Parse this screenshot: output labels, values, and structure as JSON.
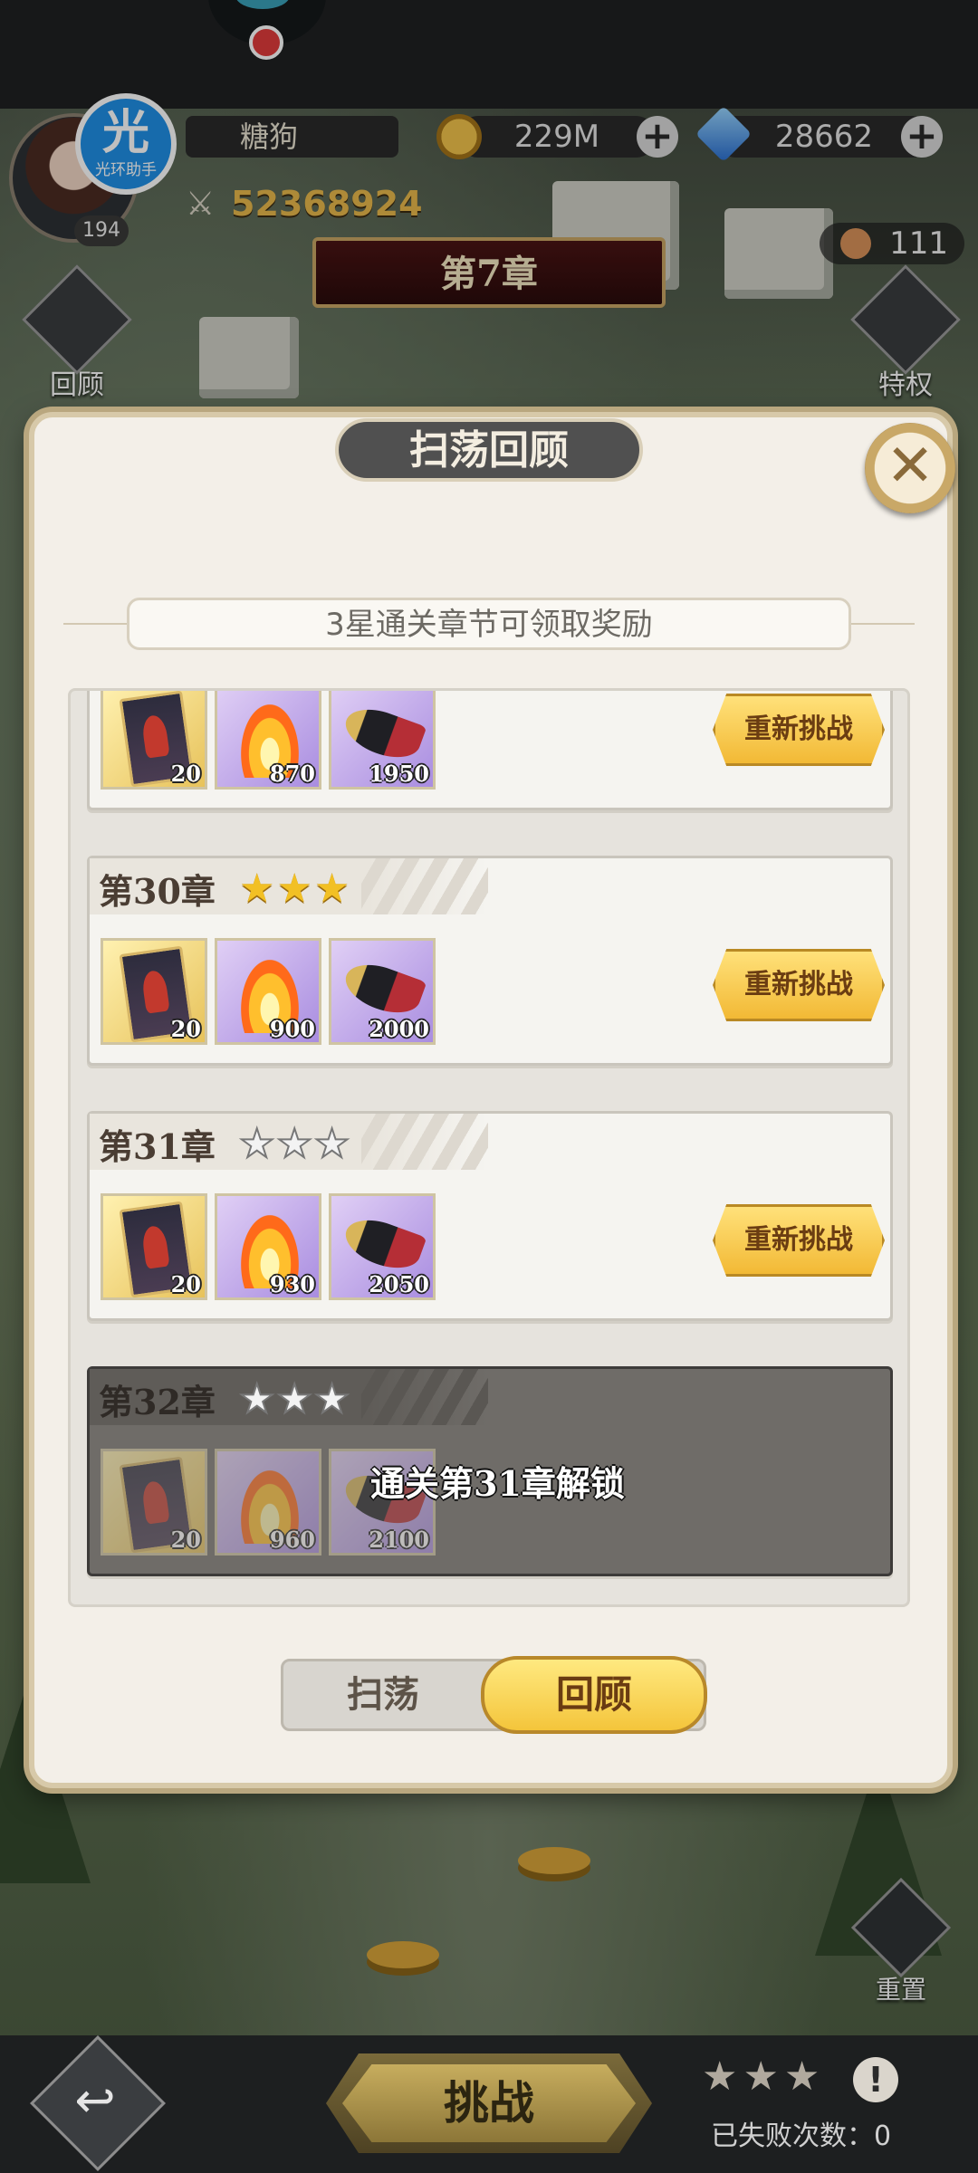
{
  "hud": {
    "player_name": "糖狗",
    "level": "194",
    "gold": "229M",
    "gems": "28662",
    "power": "52368924",
    "tokens": "111",
    "logo_glyph": "光",
    "logo_text": "光环助手",
    "chapter_banner": "第7章",
    "left_button": "回顾",
    "right_button": "特权",
    "reset_button": "重置"
  },
  "modal": {
    "title": "扫荡回顾",
    "hint": "3星通关章节可领取奖励",
    "close_icon": "close-icon"
  },
  "partial_row": {
    "items": [
      "20",
      "870",
      "1950"
    ],
    "retry_label": "重新挑战"
  },
  "chapters": [
    {
      "title": "第30章",
      "stars": 3,
      "items": [
        "20",
        "900",
        "2000"
      ],
      "retry_label": "重新挑战"
    },
    {
      "title": "第31章",
      "stars": 0,
      "items": [
        "20",
        "930",
        "2050"
      ],
      "retry_label": "重新挑战"
    },
    {
      "title": "第32章",
      "stars": 0,
      "items": [
        "20",
        "960",
        "2100"
      ],
      "locked_text": "通关第31章解锁"
    }
  ],
  "tabs": {
    "sweep": "扫荡",
    "review": "回顾"
  },
  "bottom": {
    "challenge_label": "挑战",
    "fail_count_label": "已失败次数：0",
    "stars": 3,
    "warn_glyph": "!"
  },
  "colors": {
    "accent_gold": "#f2b935",
    "star_on": "#f2c024",
    "modal_bg": "#f3efe8"
  }
}
